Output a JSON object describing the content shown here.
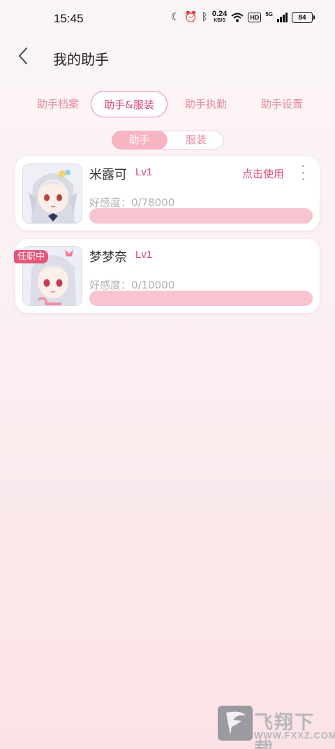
{
  "status_bar": {
    "time": "15:45",
    "net_speed": "0.24",
    "net_speed_unit": "KB/S",
    "hd": "HD",
    "network": "5G",
    "battery": "84"
  },
  "header": {
    "title": "我的助手"
  },
  "tabs": [
    {
      "label": "助手档案",
      "active": false
    },
    {
      "label": "助手&服装",
      "active": true
    },
    {
      "label": "助手执勤",
      "active": false
    },
    {
      "label": "助手设置",
      "active": false
    }
  ],
  "segment": [
    {
      "label": "助手",
      "active": true
    },
    {
      "label": "服装",
      "active": false
    }
  ],
  "assistants": [
    {
      "name": "米露可",
      "level": "Lv1",
      "action": "点击使用",
      "favor_text": "好感度：0/78000",
      "favor_progress": 0
    },
    {
      "name": "梦梦奈",
      "level": "Lv1",
      "badge": "任职中",
      "favor_text": "好感度：0/10000",
      "favor_progress": 0
    }
  ],
  "watermark": {
    "text": "飞翔下载",
    "url": "WWW.FXXZ.COM"
  },
  "colors": {
    "accent": "#d94870",
    "tab_text": "#e68aa0",
    "progress_bar": "#f7c4d0",
    "badge": "#e6557b"
  }
}
